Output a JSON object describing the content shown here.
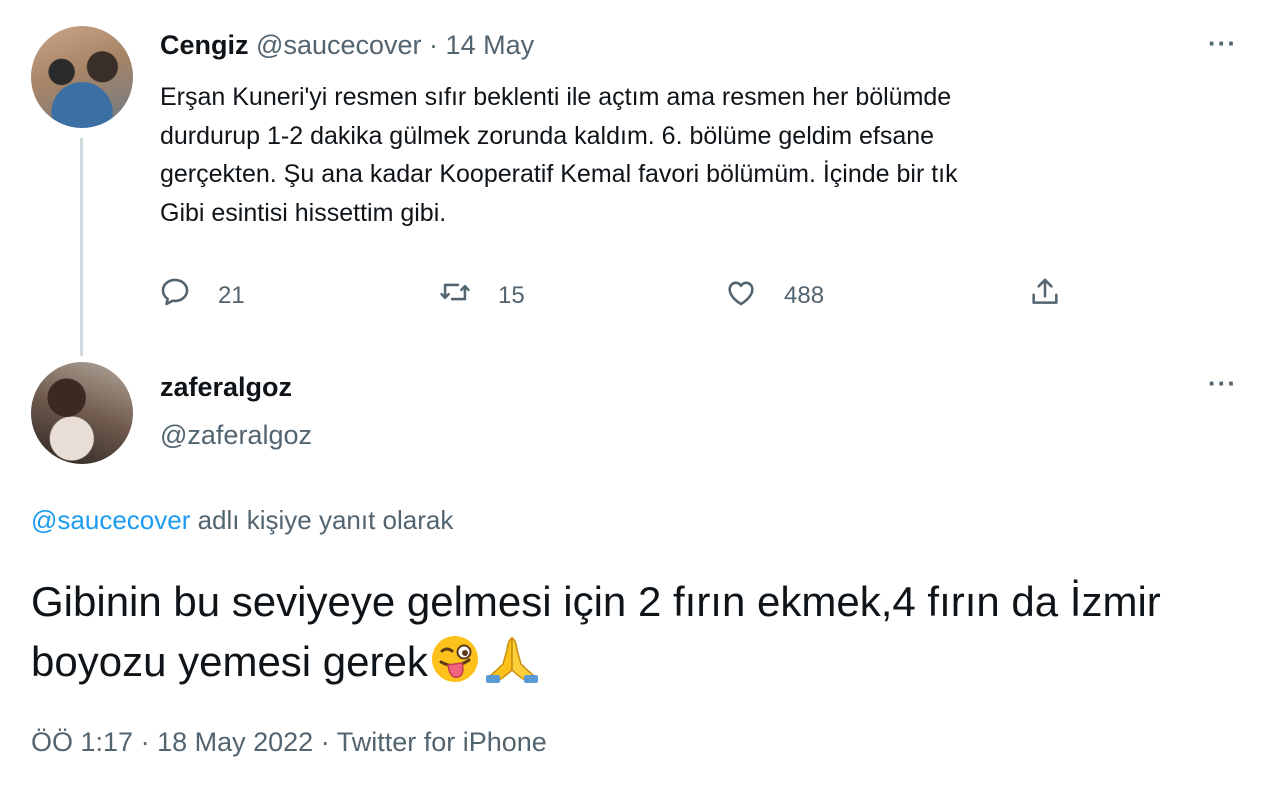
{
  "parent_tweet": {
    "display_name": "Cengiz",
    "handle": "@saucecover",
    "separator": "·",
    "date": "14 May",
    "text": "Erşan Kuneri'yi resmen sıfır beklenti ile açtım ama resmen her bölümde\ndurdurup 1-2 dakika gülmek zorunda kaldım. 6. bölüme geldim efsane\ngerçekten. Şu ana kadar Kooperatif Kemal favori bölümüm. İçinde bir tık\nGibi esintisi hissettim gibi.",
    "more_label": "···",
    "actions": {
      "reply_count": "21",
      "retweet_count": "15",
      "like_count": "488"
    }
  },
  "reply_tweet": {
    "display_name": "zaferalgoz",
    "handle": "@zaferalgoz",
    "more_label": "···",
    "replying_mention": "@saucecover",
    "replying_suffix": " adlı kişiye yanıt olarak",
    "text": "Gibinin bu seviyeye gelmesi için 2 fırın ekmek,4 fırın da İzmir boyozu yemesi gerek",
    "emojis": [
      "winking-face-with-tongue",
      "folded-hands"
    ],
    "time": "ÖÖ 1:17",
    "separator": "·",
    "date": "18 May 2022",
    "source": "Twitter for iPhone"
  },
  "colors": {
    "text": "#0f1419",
    "muted": "#536471",
    "link": "#1d9bf0",
    "thread_line": "#cfd9de"
  }
}
